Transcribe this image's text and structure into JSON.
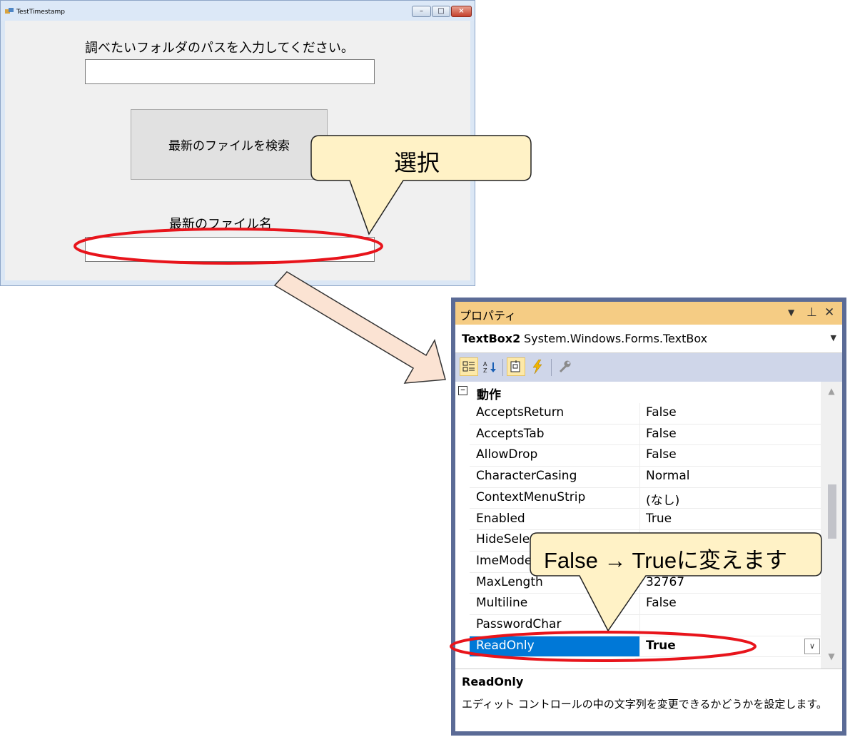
{
  "form": {
    "title": "TestTimestamp",
    "prompt_label": "調べたいフォルダのパスを入力してください。",
    "path_input_value": "",
    "search_button_label": "最新のファイルを検索",
    "result_label": "最新のファイル名",
    "result_input_value": "",
    "caption_buttons": [
      "minimize",
      "maximize",
      "close"
    ]
  },
  "callouts": {
    "select": "選択",
    "change": "False → Trueに変えます"
  },
  "properties": {
    "title": "プロパティ",
    "object_name": "TextBox2",
    "object_type": "System.Windows.Forms.TextBox",
    "category": "動作",
    "category_toggle": "日",
    "rows": [
      {
        "name": "AcceptsReturn",
        "value": "False"
      },
      {
        "name": "AcceptsTab",
        "value": "False"
      },
      {
        "name": "AllowDrop",
        "value": "False"
      },
      {
        "name": "CharacterCasing",
        "value": "Normal"
      },
      {
        "name": "ContextMenuStrip",
        "value": "(なし)"
      },
      {
        "name": "Enabled",
        "value": "True"
      },
      {
        "name": "HideSelec",
        "value": ""
      },
      {
        "name": "ImeMode",
        "value": ""
      },
      {
        "name": "MaxLength",
        "value": "32767"
      },
      {
        "name": "Multiline",
        "value": "False"
      },
      {
        "name": "PasswordChar",
        "value": ""
      },
      {
        "name": "ReadOnly",
        "value": "True"
      }
    ],
    "selected_row": "ReadOnly",
    "description_title": "ReadOnly",
    "description_text": "エディット コントロールの中の文字列を変更できるかどうかを設定します。"
  },
  "colors": {
    "highlight_ellipse": "#e8141b",
    "callout_fill": "#fff2c6",
    "arrow_fill": "#fbe3d3",
    "selection": "#0078d7",
    "panel_title": "#f5cc84",
    "panel_frame": "#5b6b96"
  }
}
